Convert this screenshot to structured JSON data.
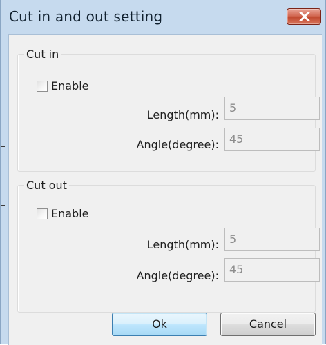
{
  "window": {
    "title": "Cut in and out setting"
  },
  "cut_in": {
    "legend": "Cut in",
    "enable_label": "Enable",
    "enable_checked": false,
    "length_label": "Length(mm):",
    "length_value": "5",
    "angle_label": "Angle(degree):",
    "angle_value": "45"
  },
  "cut_out": {
    "legend": "Cut out",
    "enable_label": "Enable",
    "enable_checked": false,
    "length_label": "Length(mm):",
    "length_value": "5",
    "angle_label": "Angle(degree):",
    "angle_value": "45"
  },
  "buttons": {
    "ok_label": "Ok",
    "cancel_label": "Cancel"
  },
  "icons": {
    "close": "close-icon"
  },
  "colors": {
    "frame": "#c6daee",
    "client": "#f0f0f0",
    "close_button": "#c75a40",
    "ok_button_border": "#3c7fb1",
    "disabled_text": "#8d8d8d"
  }
}
